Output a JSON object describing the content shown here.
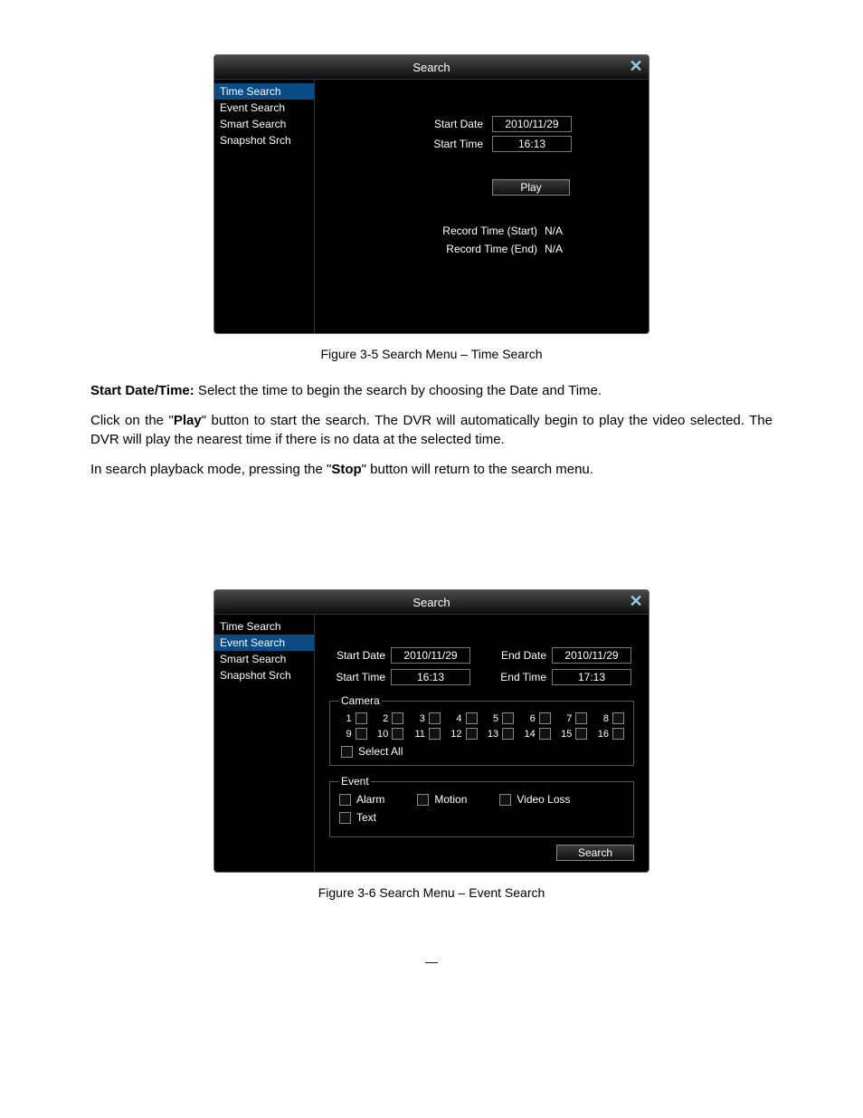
{
  "figure1": {
    "title": "Search",
    "sidebar": [
      "Time Search",
      "Event Search",
      "Smart Search",
      "Snapshot Srch"
    ],
    "selected": 0,
    "start_date_label": "Start Date",
    "start_date_value": "2010/11/29",
    "start_time_label": "Start Time",
    "start_time_value": "16:13",
    "play_label": "Play",
    "record_start_label": "Record Time (Start)",
    "record_start_value": "N/A",
    "record_end_label": "Record Time (End)",
    "record_end_value": "N/A",
    "caption": "Figure 3-5 Search Menu – Time Search"
  },
  "text": {
    "p1_strong": "Start Date/Time:",
    "p1_rest": " Select the time to begin the search by choosing the Date and Time.",
    "p2_a": "Click on the \"",
    "p2_b": "Play",
    "p2_c": "\" button to start the search. The DVR will automatically begin to play the video selected. The DVR will play the nearest time if there is no data at the selected time.",
    "p3_a": "In search playback mode, pressing the \"",
    "p3_b": "Stop",
    "p3_c": "\" button will return to the search menu."
  },
  "figure2": {
    "title": "Search",
    "sidebar": [
      "Time Search",
      "Event Search",
      "Smart Search",
      "Snapshot Srch"
    ],
    "selected": 1,
    "start_date_label": "Start Date",
    "start_date_value": "2010/11/29",
    "end_date_label": "End Date",
    "end_date_value": "2010/11/29",
    "start_time_label": "Start Time",
    "start_time_value": "16:13",
    "end_time_label": "End Time",
    "end_time_value": "17:13",
    "camera_legend": "Camera",
    "cameras": [
      "1",
      "2",
      "3",
      "4",
      "5",
      "6",
      "7",
      "8",
      "9",
      "10",
      "11",
      "12",
      "13",
      "14",
      "15",
      "16"
    ],
    "select_all_label": "Select All",
    "event_legend": "Event",
    "events": [
      "Alarm",
      "Motion",
      "Video Loss",
      "Text"
    ],
    "search_label": "Search",
    "caption": "Figure 3-6 Search Menu – Event Search"
  },
  "page_dash": "—"
}
